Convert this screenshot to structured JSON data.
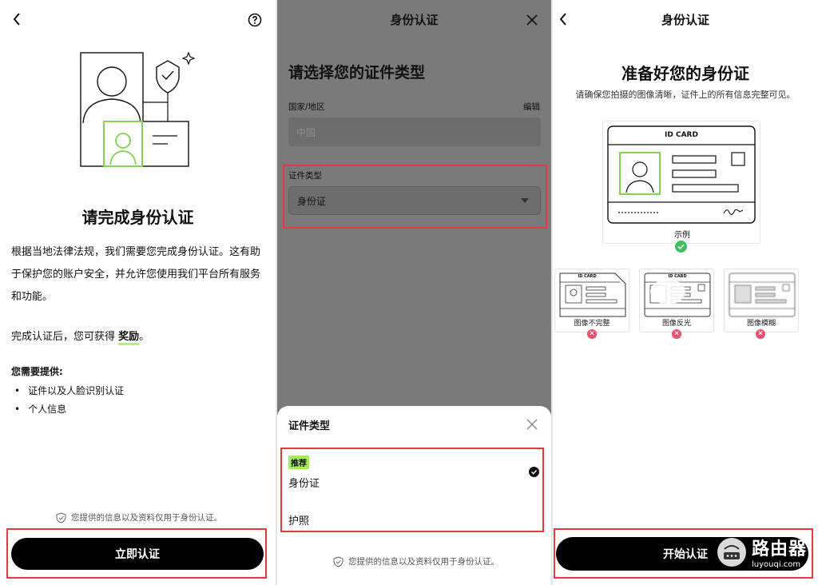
{
  "screen1": {
    "title": "请完成身份认证",
    "paragraph1": "根据当地法律法规，我们需要您完成身份认证。这有助于保护您的账户安全，并允许您使用我们平台所有服务和功能。",
    "paragraph2_prefix": "完成认证后，您可获得 ",
    "paragraph2_reward": "奖励",
    "paragraph2_suffix": "。",
    "need_heading": "您需要提供:",
    "need_items": [
      "证件以及人脸识别认证",
      "个人信息"
    ],
    "privacy_note": "您提供的信息以及资料仅用于身份认证。",
    "verify_button": "立即认证"
  },
  "screen2": {
    "header_title": "身份认证",
    "heading": "请选择您的证件类型",
    "country_label": "国家/地区",
    "edit_label": "编辑",
    "country_value": "中国",
    "doc_type_label": "证件类型",
    "doc_type_value": "身份证",
    "sheet": {
      "title": "证件类型",
      "recommend_badge": "推荐",
      "options": [
        "身份证",
        "护照"
      ]
    },
    "privacy_note": "您提供的信息以及资料仅用于身份认证。"
  },
  "screen3": {
    "header_title": "身份认证",
    "heading": "准备好您的身份证",
    "subtitle": "请确保您拍摄的图像清晰，证件上的所有信息完整可见。",
    "card_title": "ID CARD",
    "small_card_title": "ID CARD",
    "example_label": "示例",
    "bad_examples": [
      "图像不完整",
      "图像反光",
      "图像模糊"
    ],
    "start_button": "开始认证"
  },
  "watermark": {
    "brand": "路由器",
    "domain": "luyouqi.com"
  },
  "colors": {
    "accent_green": "#a5ec5b",
    "highlight_red": "#e5393d",
    "error_pink": "#e8506b",
    "button_black": "#000000"
  }
}
